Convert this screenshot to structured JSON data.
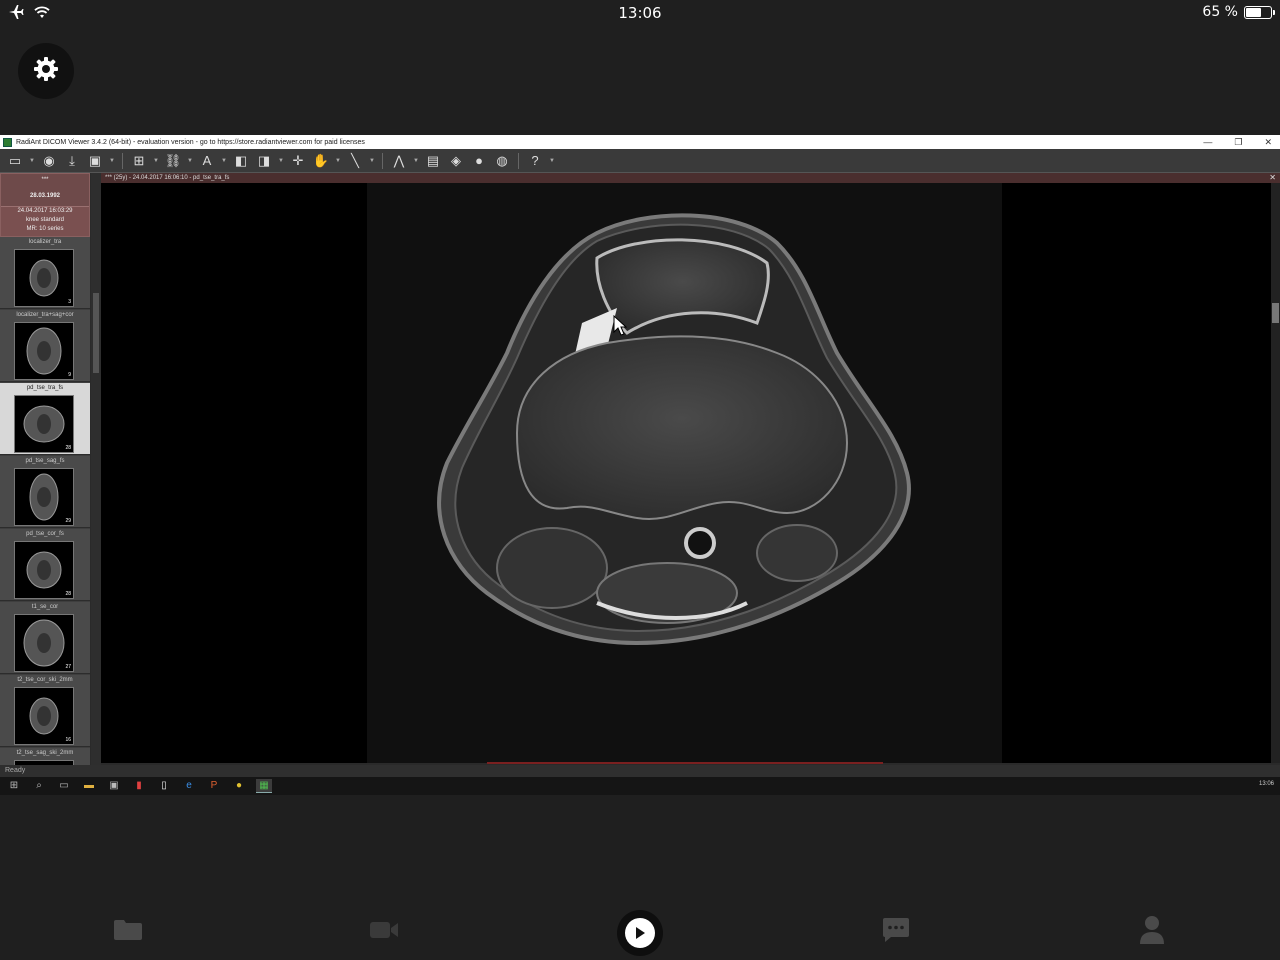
{
  "status_bar": {
    "time": "13:06",
    "battery_text": "65 %",
    "battery_level": 0.65,
    "icons": [
      "airplane-icon",
      "wifi-icon",
      "battery-icon"
    ]
  },
  "remote": {
    "window_title": "RadiAnt DICOM Viewer 3.4.2 (64-bit) - evaluation version - go to https://store.radiantviewer.com for paid licenses",
    "window_controls": {
      "minimize": "—",
      "maximize": "❐",
      "close": "✕"
    },
    "patient": {
      "name": "***",
      "birth_date": "28.03.1992",
      "study_datetime": "24.04.2017 16:03:29",
      "study_desc": "knee standard",
      "modality": "MR: 10 series"
    },
    "series": [
      {
        "label": "localizer_tra",
        "count": "3"
      },
      {
        "label": "localizer_tra+sag+cor",
        "count": "9"
      },
      {
        "label": "pd_tse_tra_fs",
        "count": "28"
      },
      {
        "label": "pd_tse_sag_fs",
        "count": "29"
      },
      {
        "label": "pd_tse_cor_fs",
        "count": "28"
      },
      {
        "label": "t1_se_cor",
        "count": "27"
      },
      {
        "label": "t2_tse_cor_ski_2mm",
        "count": "16"
      },
      {
        "label": "t2_tse_sag_ski_2mm",
        "count": ""
      }
    ],
    "active_series": 2,
    "viewer_header": "*** (25y) - 24.04.2017 16:06:10 - pd_tse_tra_fs",
    "viewer_close": "✕",
    "status_text": "Ready",
    "taskbar_clock": "13:06"
  }
}
